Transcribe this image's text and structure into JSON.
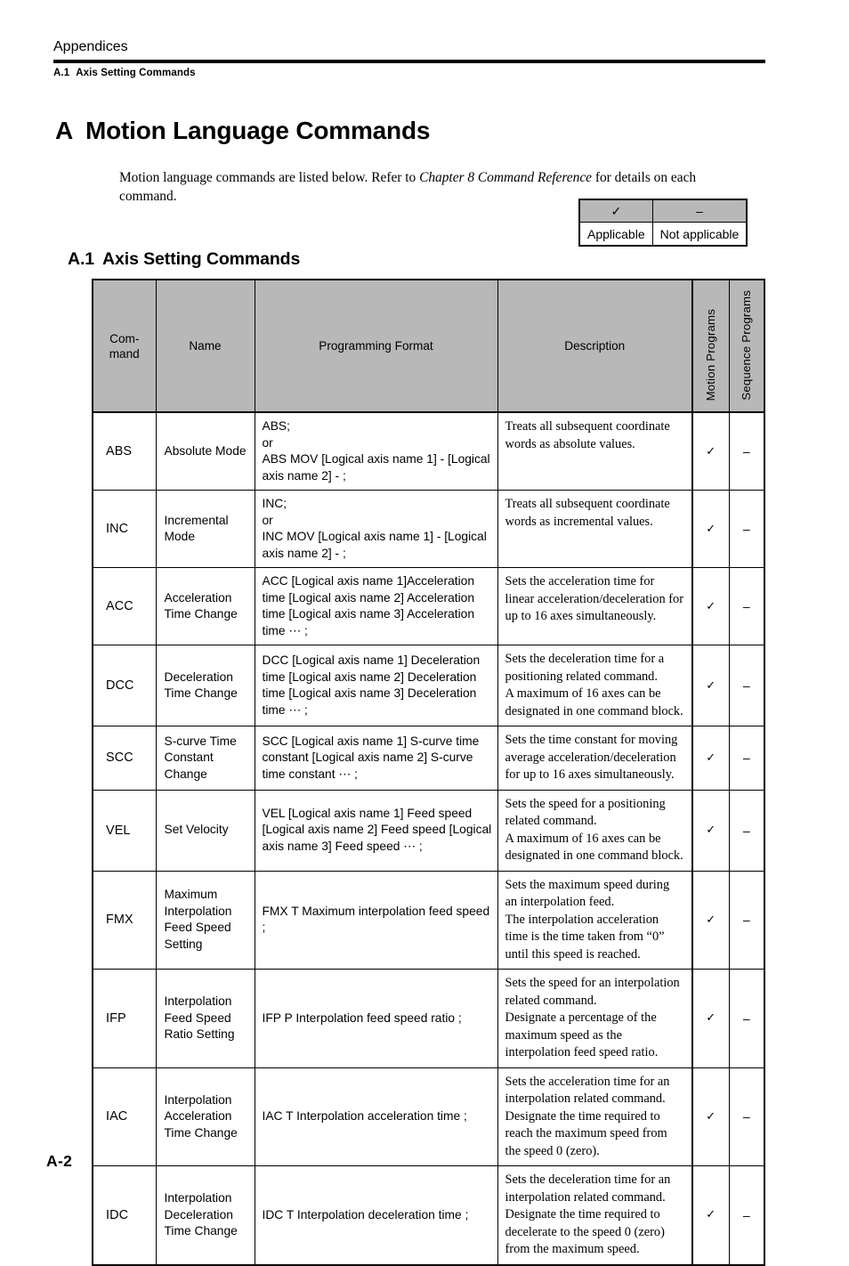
{
  "header": {
    "appendices": "Appendices",
    "subsection_number": "A.1",
    "subsection_title": "Axis Setting Commands"
  },
  "chapter": {
    "label": "A",
    "title": "Motion Language Commands"
  },
  "intro": {
    "text_before": "Motion language commands are listed below. Refer to ",
    "italic_ref": "Chapter 8 Command Reference",
    "text_after": " for details on each command."
  },
  "legend": {
    "check_symbol": "✓",
    "dash_symbol": "–",
    "check_label": "Applicable",
    "dash_label": "Not applicable"
  },
  "section": {
    "number": "A.1",
    "title": "Axis Setting Commands"
  },
  "table": {
    "headers": {
      "command": "Com-\nmand",
      "command_line1": "Com-",
      "command_line2": "mand",
      "name": "Name",
      "format": "Programming Format",
      "description": "Description",
      "motion_programs": "Motion Programs",
      "sequence_programs": "Sequence Programs"
    },
    "rows": [
      {
        "command": "ABS",
        "name": "Absolute Mode",
        "format": "ABS;\nor\nABS MOV [Logical axis name 1] - [Logical axis name 2] - ;",
        "description": "Treats all subsequent coordinate words as absolute values.",
        "motion": "✓",
        "sequence": "–"
      },
      {
        "command": "INC",
        "name": "Incremental Mode",
        "format": "INC;\nor\nINC MOV [Logical axis name 1] - [Logical axis name 2] - ;",
        "description": "Treats all subsequent coordinate words as incremental values.",
        "motion": "✓",
        "sequence": "–"
      },
      {
        "command": "ACC",
        "name": "Acceleration Time Change",
        "format": "ACC [Logical axis name 1]Acceleration time [Logical axis name 2] Acceleration time [Logical axis name 3] Acceleration time ⋯ ;",
        "description": "Sets the acceleration time for linear acceleration/deceleration for up to 16 axes simultaneously.",
        "motion": "✓",
        "sequence": "–"
      },
      {
        "command": "DCC",
        "name": "Deceleration Time Change",
        "format": "DCC [Logical axis name 1] Deceleration time [Logical axis name 2] Deceleration time [Logical axis name 3] Deceleration time ⋯ ;",
        "description": "Sets the deceleration time for a positioning related command.\nA maximum of 16 axes can be designated in one command block.",
        "motion": "✓",
        "sequence": "–"
      },
      {
        "command": "SCC",
        "name": "S-curve Time Constant Change",
        "format": "SCC [Logical axis name 1] S-curve time constant [Logical axis name 2] S-curve time constant ⋯ ;",
        "description": "Sets the time constant for moving average acceleration/deceleration for up to 16 axes simultaneously.",
        "motion": "✓",
        "sequence": "–"
      },
      {
        "command": "VEL",
        "name": "Set Velocity",
        "format": "VEL [Logical axis name 1] Feed speed [Logical axis name 2] Feed speed [Logical axis name 3] Feed speed ⋯ ;",
        "description": "Sets the speed for a positioning related command.\nA maximum of 16 axes can be designated in one command block.",
        "motion": "✓",
        "sequence": "–"
      },
      {
        "command": "FMX",
        "name": "Maximum Interpolation Feed Speed Setting",
        "format": "FMX T Maximum interpolation feed speed ;",
        "description": "Sets the maximum speed during an interpolation feed.\nThe interpolation acceleration time is the time taken from “0” until this speed is reached.",
        "motion": "✓",
        "sequence": "–"
      },
      {
        "command": "IFP",
        "name": "Interpolation Feed Speed Ratio Setting",
        "format": "IFP P Interpolation feed speed ratio ;",
        "description": "Sets the speed for an interpolation related command.\nDesignate a percentage of the maximum speed as the interpolation feed speed ratio.",
        "motion": "✓",
        "sequence": "–"
      },
      {
        "command": "IAC",
        "name": "Interpolation Acceleration Time Change",
        "format": "IAC T Interpolation acceleration time ;",
        "description": "Sets the acceleration time for an interpolation related command.\nDesignate the time required to reach the maximum speed from the speed 0 (zero).",
        "motion": "✓",
        "sequence": "–"
      },
      {
        "command": "IDC",
        "name": "Interpolation Deceleration Time Change",
        "format": "IDC T Interpolation deceleration time ;",
        "description": "Sets the deceleration time for an interpolation related command.\nDesignate the time required to decelerate to the speed 0 (zero) from the maximum speed.",
        "motion": "✓",
        "sequence": "–"
      }
    ]
  },
  "footer": {
    "page_number": "A-2"
  },
  "colors": {
    "header_fill": "#b8b8b8",
    "rule": "#000000"
  }
}
